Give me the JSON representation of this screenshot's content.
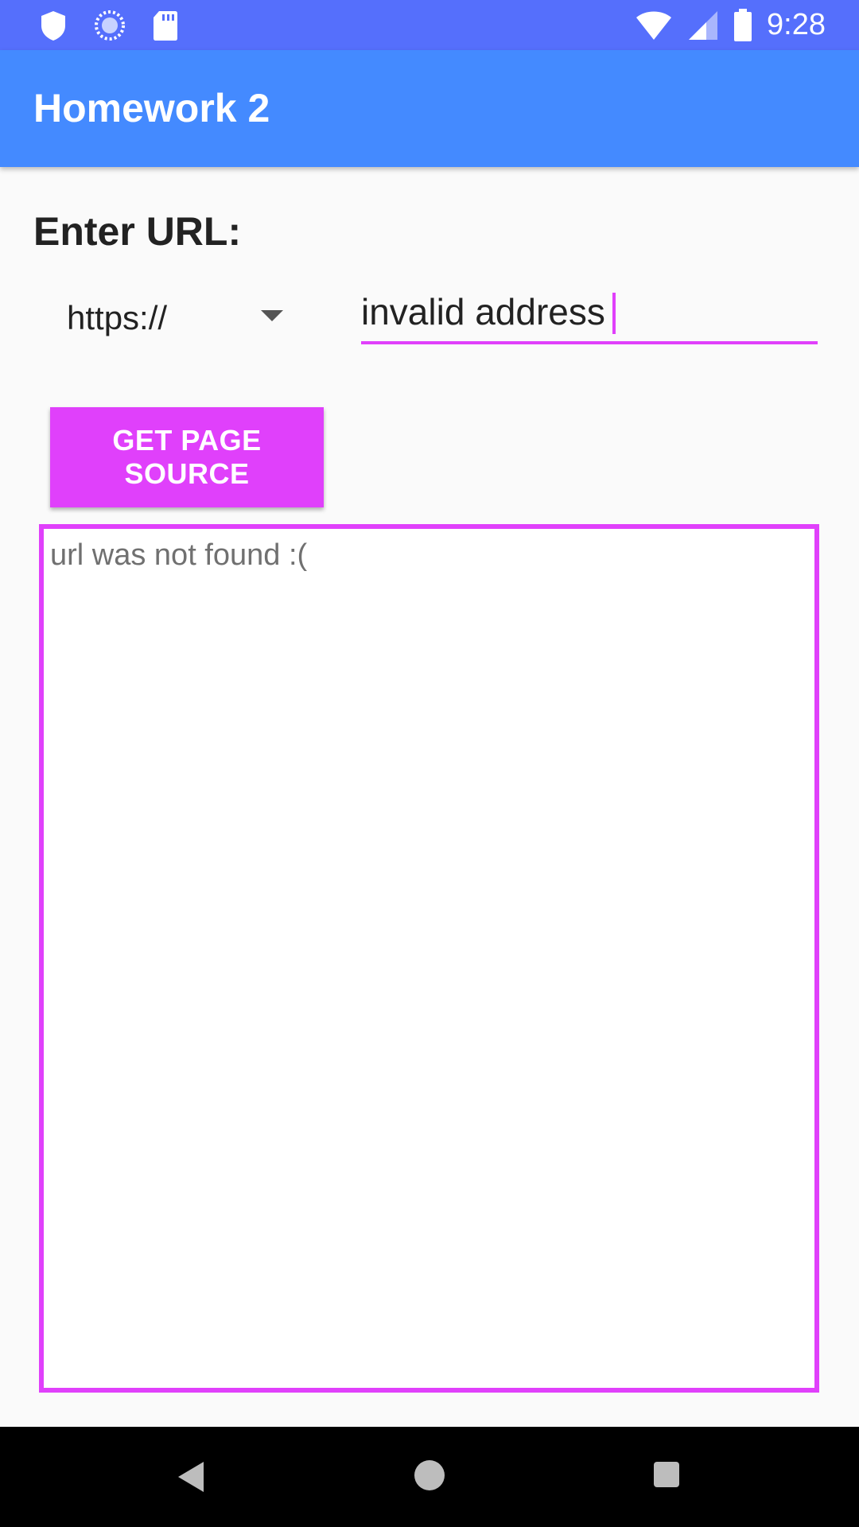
{
  "status_bar": {
    "time": "9:28",
    "left_icons": [
      "shield-icon",
      "sync-icon",
      "sd-card-icon"
    ],
    "right_icons": [
      "wifi-icon",
      "signal-icon",
      "battery-icon"
    ]
  },
  "app_bar": {
    "title": "Homework 2",
    "color": "#448aff"
  },
  "form": {
    "label": "Enter URL:",
    "protocol_spinner": {
      "selected": "https://"
    },
    "url_input": {
      "value": "invalid address",
      "placeholder": ""
    },
    "button_label": "GET PAGE SOURCE",
    "accent_color": "#e040fb"
  },
  "output": {
    "text": "url was not found :("
  },
  "nav_bar": {
    "buttons": [
      "back-icon",
      "home-icon",
      "recents-icon"
    ]
  }
}
